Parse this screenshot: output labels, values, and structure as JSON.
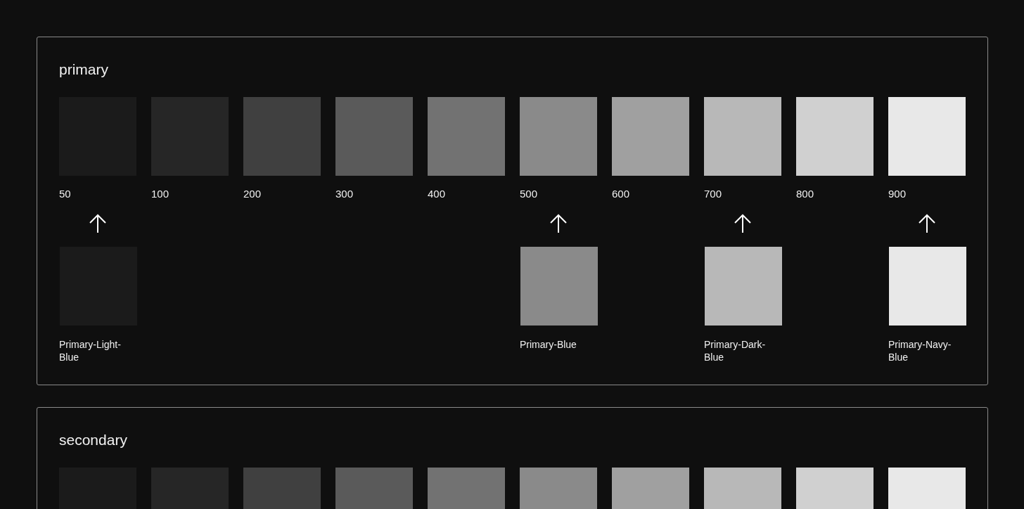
{
  "sections": [
    {
      "title": "primary",
      "shades": [
        {
          "label": "50",
          "color": "#1b1b1b"
        },
        {
          "label": "100",
          "color": "#262626"
        },
        {
          "label": "200",
          "color": "#404040"
        },
        {
          "label": "300",
          "color": "#5a5a5a"
        },
        {
          "label": "400",
          "color": "#727272"
        },
        {
          "label": "500",
          "color": "#8a8a8a"
        },
        {
          "label": "600",
          "color": "#a0a0a0"
        },
        {
          "label": "700",
          "color": "#b8b8b8"
        },
        {
          "label": "800",
          "color": "#d0d0d0"
        },
        {
          "label": "900",
          "color": "#e8e8e8"
        }
      ],
      "aliases": [
        {
          "kind": "alias",
          "label": "Primary-Light-Blue",
          "color": "#1b1b1b"
        },
        {
          "kind": "empty"
        },
        {
          "kind": "empty"
        },
        {
          "kind": "empty"
        },
        {
          "kind": "empty"
        },
        {
          "kind": "alias",
          "label": "Primary-Blue",
          "color": "#8a8a8a"
        },
        {
          "kind": "empty"
        },
        {
          "kind": "alias",
          "label": "Primary-Dark-Blue",
          "color": "#b8b8b8"
        },
        {
          "kind": "empty"
        },
        {
          "kind": "alias",
          "label": "Primary-Navy-Blue",
          "color": "#e8e8e8"
        }
      ]
    },
    {
      "title": "secondary",
      "shades": [
        {
          "color": "#1b1b1b"
        },
        {
          "color": "#262626"
        },
        {
          "color": "#404040"
        },
        {
          "color": "#5a5a5a"
        },
        {
          "color": "#727272"
        },
        {
          "color": "#8a8a8a"
        },
        {
          "color": "#a0a0a0"
        },
        {
          "color": "#b8b8b8"
        },
        {
          "color": "#d0d0d0"
        },
        {
          "color": "#e8e8e8"
        }
      ]
    }
  ]
}
